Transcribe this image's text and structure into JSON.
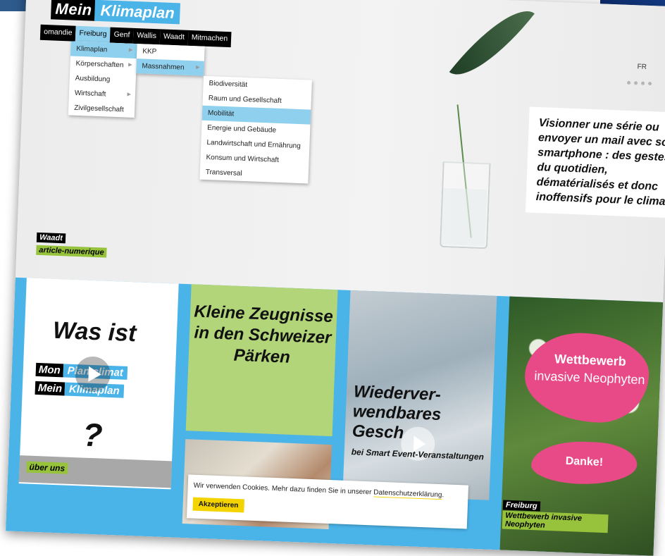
{
  "logo": {
    "mein": "Mein",
    "klimaplan": "Klimaplan"
  },
  "nav": {
    "items": [
      "omandie",
      "Freiburg",
      "Genf",
      "Wallis",
      "Waadt",
      "Mitmachen"
    ],
    "lang": "FR"
  },
  "menu_l1": {
    "items": [
      "Klimaplan",
      "Körperschaften",
      "Ausbildung",
      "Wirtschaft",
      "Zivilgesellschaft"
    ]
  },
  "menu_l2": {
    "items": [
      "KKP",
      "Massnahmen"
    ]
  },
  "menu_l3": {
    "items": [
      "Biodiversität",
      "Raum und Gesellschaft",
      "Mobilität",
      "Energie und Gebäude",
      "Landwirtschaft und Ernährung",
      "Konsum und Wirtschaft",
      "Transversal"
    ]
  },
  "hero": {
    "quote": "Visionner une série ou envoyer un mail avec son smartphone : des gestes du quotidien, dématérialisés et donc inoffensifs pour le climat ?",
    "tag_canton": "Waadt",
    "tag_article": "article-numerique"
  },
  "card1": {
    "title": "Was ist",
    "row1_a": "Mon",
    "row1_b": "Plan climat",
    "row2_a": "Mein",
    "row2_b": "Klimaplan",
    "question": "?",
    "link": "über uns"
  },
  "card2": {
    "title": "Kleine Zeugnisse in den Schweizer Pärken"
  },
  "card3": {
    "title": "Wiederver-wendbares Gesch",
    "subtitle": "bei Smart Event-Veranstaltungen"
  },
  "card4": {
    "title1": "Wettbewerb",
    "title2": "invasive Neophyten",
    "cta": "Danke!",
    "tag_canton": "Freiburg",
    "tag_title": "Wettbewerb invasive Neophyten"
  },
  "cookie": {
    "text": "Wir verwenden Cookies. Mehr dazu finden Sie in unserer",
    "link": "Datenschutzerklärung",
    "button": "Akzeptieren"
  },
  "colors": {
    "accent_blue": "#4ab3e8",
    "green": "#97c23c",
    "pink": "#e84a87",
    "yellow": "#f4d400"
  }
}
